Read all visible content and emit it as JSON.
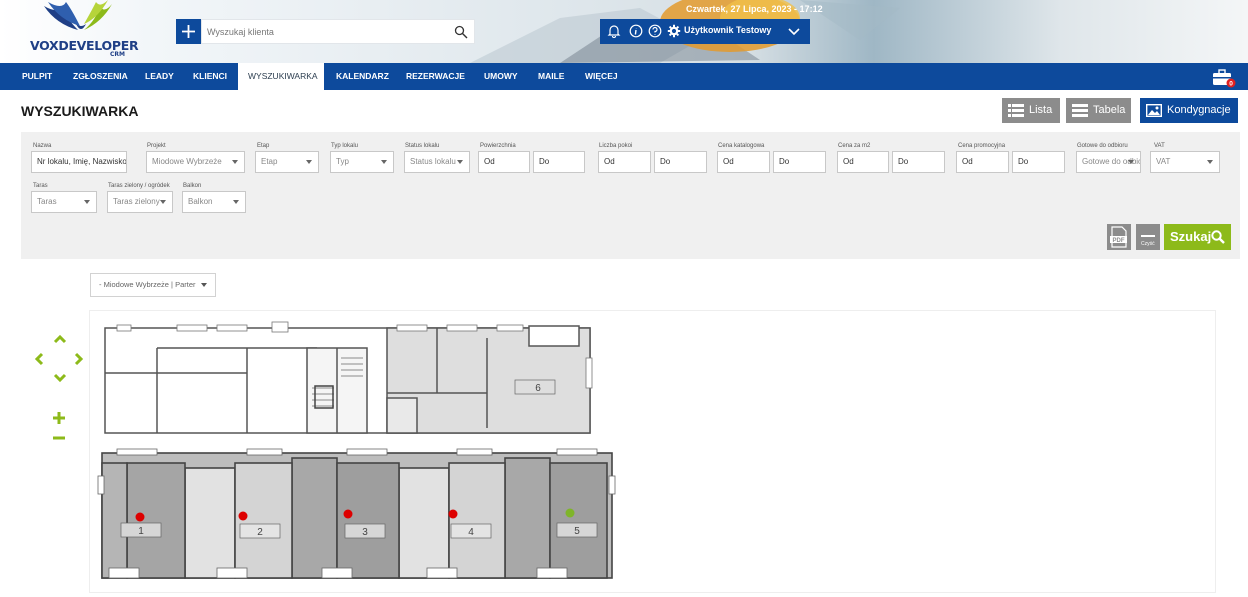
{
  "header": {
    "logo_text_main": "VOXDEVELOPER",
    "logo_text_sub": "CRM",
    "search_placeholder": "Wyszukaj klienta",
    "date": "Czwartek, 27 Lipca, 2023 - 17:12",
    "user_name": "Użytkownik Testowy",
    "icons": [
      "bell-icon",
      "info-icon",
      "help-icon",
      "gear-icon",
      "chevron-down-icon",
      "search-icon",
      "plus-icon"
    ],
    "brand_color": "#0d4a9c",
    "accent_color": "#8dba1a"
  },
  "nav": {
    "items": [
      {
        "label": "PULPIT"
      },
      {
        "label": "ZGŁOSZENIA"
      },
      {
        "label": "LEADY"
      },
      {
        "label": "KLIENCI"
      },
      {
        "label": "WYSZUKIWARKA",
        "active": true
      },
      {
        "label": "KALENDARZ"
      },
      {
        "label": "REZERWACJE"
      },
      {
        "label": "UMOWY"
      },
      {
        "label": "MAILE"
      },
      {
        "label": "WIĘCEJ"
      }
    ],
    "briefcase_badge": "0"
  },
  "page": {
    "title": "WYSZUKIWARKA",
    "view_buttons": {
      "lista": "Lista",
      "tabela": "Tabela",
      "kondygnacje": "Kondygnacje"
    }
  },
  "filters": {
    "nazwa": {
      "label": "Nazwa",
      "value": "Nr lokalu, Imię, Nazwisko"
    },
    "projekt": {
      "label": "Projekt",
      "value": "Miodowe Wybrzeże"
    },
    "etap": {
      "label": "Etap",
      "value": "Etap"
    },
    "typ": {
      "label": "Typ lokalu",
      "value": "Typ"
    },
    "status": {
      "label": "Status lokalu",
      "value": "Status lokalu"
    },
    "powierzchnia": {
      "label": "Powierzchnia",
      "from": "Od",
      "to": "Do"
    },
    "pokoje": {
      "label": "Liczba pokoi",
      "from": "Od",
      "to": "Do"
    },
    "cena_kat": {
      "label": "Cena katalogowa",
      "from": "Od",
      "to": "Do"
    },
    "cena_m2": {
      "label": "Cena za m2",
      "from": "Od",
      "to": "Do"
    },
    "cena_promo": {
      "label": "Cena promocyjna",
      "from": "Od",
      "to": "Do"
    },
    "gotowe": {
      "label": "Gotowe do odbioru",
      "value": "Gotowe do odbioru"
    },
    "vat": {
      "label": "VAT",
      "value": "VAT"
    },
    "taras": {
      "label": "Taras",
      "value": "Taras"
    },
    "taras_zielony": {
      "label": "Taras zielony / ogródek",
      "value": "Taras zielony"
    },
    "balkon": {
      "label": "Balkon",
      "value": "Balkon"
    },
    "pdf_label": "PDF",
    "clear_label": "Czyść",
    "search_label": "Szukaj"
  },
  "floor": {
    "selected": "- Miodowe Wybrzeże | Parter"
  },
  "units": [
    {
      "number": "1",
      "status_color": "#dd0000"
    },
    {
      "number": "2",
      "status_color": "#dd0000"
    },
    {
      "number": "3",
      "status_color": "#dd0000"
    },
    {
      "number": "4",
      "status_color": "#dd0000"
    },
    {
      "number": "5",
      "status_color": "#7fb52a"
    },
    {
      "number": "6",
      "status_color": "#f08a12"
    }
  ]
}
